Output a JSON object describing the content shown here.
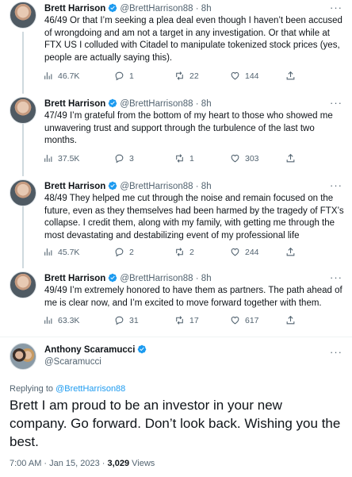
{
  "thread": [
    {
      "name": "Brett Harrison",
      "handle": "@BrettHarrison88",
      "dot": "·",
      "time": "8h",
      "text": "46/49 Or that I’m seeking a plea deal even though I haven’t been accused of wrongdoing and am not a target in any investigation. Or that while at FTX US I colluded with Citadel to manipulate tokenized stock prices (yes, people are actually saying this).",
      "views": "46.7K",
      "replies": "1",
      "retweets": "22",
      "likes": "144"
    },
    {
      "name": "Brett Harrison",
      "handle": "@BrettHarrison88",
      "dot": "·",
      "time": "8h",
      "text": "47/49 I’m grateful from the bottom of my heart to those who showed me unwavering trust and support through the turbulence of the last two months.",
      "views": "37.5K",
      "replies": "3",
      "retweets": "1",
      "likes": "303"
    },
    {
      "name": "Brett Harrison",
      "handle": "@BrettHarrison88",
      "dot": "·",
      "time": "8h",
      "text": "48/49 They helped me cut through the noise and remain focused on the future, even as they themselves had been harmed by the tragedy of FTX’s collapse. I credit them, along with my family, with getting me through the most devastating and destabilizing event of my professional life",
      "views": "45.7K",
      "replies": "2",
      "retweets": "2",
      "likes": "244"
    },
    {
      "name": "Brett Harrison",
      "handle": "@BrettHarrison88",
      "dot": "·",
      "time": "8h",
      "text": "49/49 I’m extremely honored to have them as partners. The path ahead of me is clear now, and I’m excited to move forward together with them.",
      "views": "63.3K",
      "replies": "31",
      "retweets": "17",
      "likes": "617"
    }
  ],
  "reply": {
    "name": "Anthony Scaramucci",
    "handle": "@Scaramucci",
    "replying_prefix": "Replying to ",
    "replying_to": "@BrettHarrison88",
    "text": "Brett I am proud to be an investor in your new company. Go forward. Don’t look back.  Wishing you the best.",
    "timestamp": "7:00 AM · Jan 15, 2023 · ",
    "views_count": "3,029",
    "views_label": " Views"
  },
  "more_label": "···",
  "colors": {
    "verified": "#1d9bf0",
    "secondary": "#536471",
    "link": "#1d9bf0"
  },
  "icons": [
    "views-icon",
    "reply-icon",
    "retweet-icon",
    "like-icon",
    "share-icon",
    "verified-icon",
    "more-icon"
  ]
}
